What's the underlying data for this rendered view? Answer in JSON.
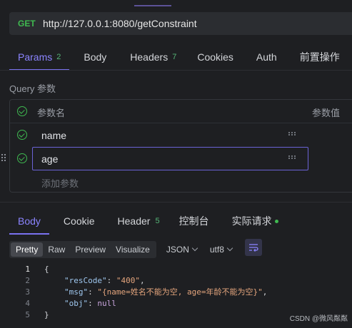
{
  "request": {
    "method": "GET",
    "url": "http://127.0.0.1:8080/getConstraint"
  },
  "request_tabs": [
    {
      "label": "Params",
      "count": "2",
      "active": true
    },
    {
      "label": "Body",
      "count": "",
      "active": false
    },
    {
      "label": "Headers",
      "count": "7",
      "active": false
    },
    {
      "label": "Cookies",
      "count": "",
      "active": false
    },
    {
      "label": "Auth",
      "count": "",
      "active": false
    },
    {
      "label": "前置操作",
      "count": "",
      "active": false
    }
  ],
  "query": {
    "section_label": "Query 参数",
    "col_name": "参数名",
    "col_value": "参数值",
    "rows": [
      {
        "name": "name",
        "checked": true
      },
      {
        "name": "age",
        "checked": true
      }
    ],
    "add_placeholder": "添加参数"
  },
  "response_tabs": [
    {
      "label": "Body",
      "count": "",
      "active": true
    },
    {
      "label": "Cookie",
      "count": "",
      "active": false
    },
    {
      "label": "Header",
      "count": "5",
      "active": false
    },
    {
      "label": "控制台",
      "count": "",
      "active": false
    },
    {
      "label": "实际请求",
      "count": "",
      "active": false,
      "dot": true
    }
  ],
  "format": {
    "modes": [
      "Pretty",
      "Raw",
      "Preview",
      "Visualize"
    ],
    "active_mode": "Pretty",
    "type": "JSON",
    "encoding": "utf8"
  },
  "code_lines": [
    {
      "num": "1",
      "text": "{"
    },
    {
      "num": "2",
      "key": "\"resCode\"",
      "value": "\"400\"",
      "suffix": ","
    },
    {
      "num": "3",
      "key": "\"msg\"",
      "value": "\"{name=姓名不能为空, age=年龄不能为空}\"",
      "suffix": ","
    },
    {
      "num": "4",
      "key": "\"obj\"",
      "value": "null",
      "suffix": ""
    },
    {
      "num": "5",
      "text": "}"
    }
  ],
  "watermark": "CSDN @微风粼粼",
  "colors": {
    "accent": "#7a72f0",
    "method_get": "#3fb950",
    "json_key": "#9fc7ef",
    "json_string": "#e3a47c"
  }
}
